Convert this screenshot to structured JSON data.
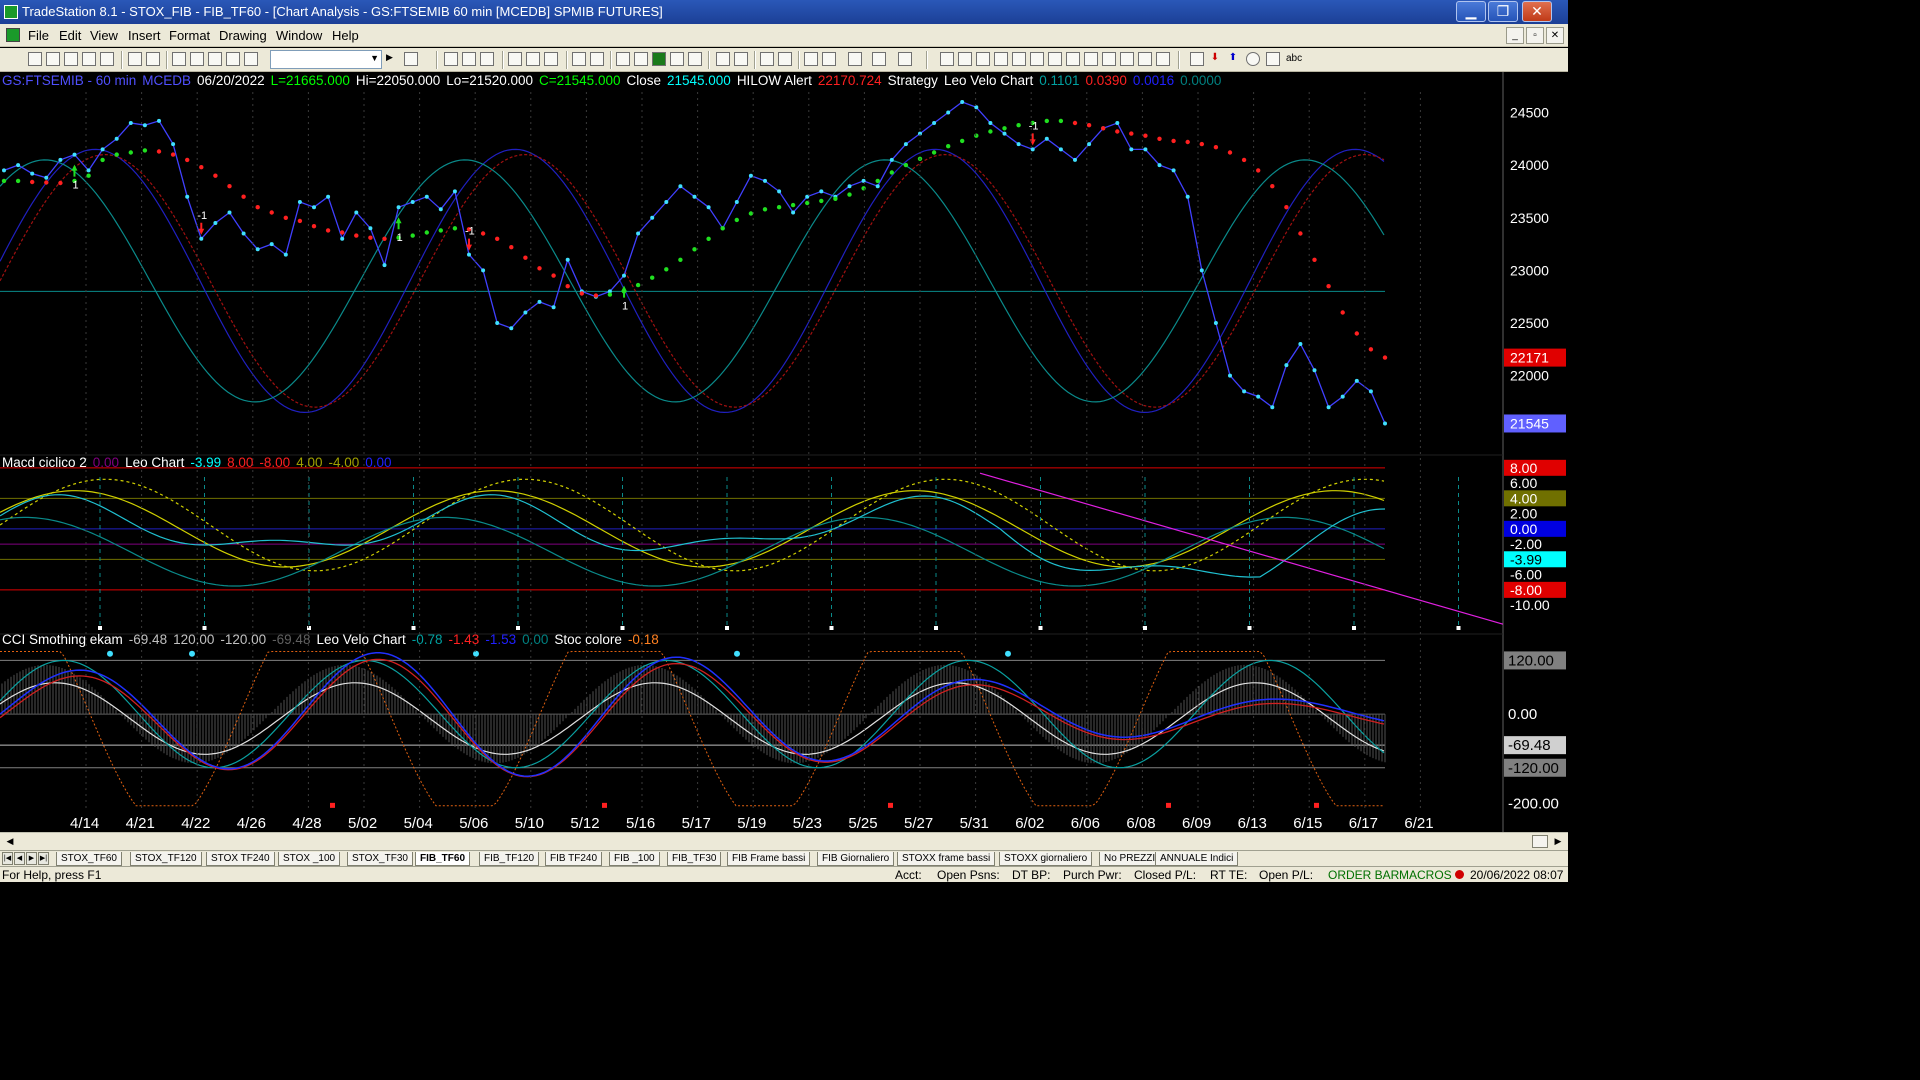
{
  "window": {
    "title": "TradeStation 8.1 - STOX_FIB - FIB_TF60 - [Chart Analysis - GS:FTSEMIB  60 min  [MCEDB] SPMIB FUTURES]",
    "min": "▁",
    "max": "❐",
    "close": "✕"
  },
  "menu": [
    "File",
    "Edit",
    "View",
    "Insert",
    "Format",
    "Drawing",
    "Window",
    "Help"
  ],
  "mdi": [
    "_",
    "▫",
    "✕"
  ],
  "toolbar": {
    "text_tool": "abc"
  },
  "price_header": [
    {
      "t": "GS:FTSEMIB - 60 min",
      "c": "#5050ff"
    },
    {
      "t": "MCEDB",
      "c": "#5050ff"
    },
    {
      "t": "06/20/2022",
      "c": "#ffffff"
    },
    {
      "t": "L=21665.000",
      "c": "#00ff00"
    },
    {
      "t": "Hi=22050.000",
      "c": "#ffffff"
    },
    {
      "t": "Lo=21520.000",
      "c": "#ffffff"
    },
    {
      "t": "C=21545.000",
      "c": "#00ff00"
    },
    {
      "t": "Close",
      "c": "#ffffff"
    },
    {
      "t": "21545.000",
      "c": "#00ffff"
    },
    {
      "t": "HILOW Alert",
      "c": "#ffffff"
    },
    {
      "t": "22170.724",
      "c": "#ff2020"
    },
    {
      "t": "Strategy",
      "c": "#ffffff"
    },
    {
      "t": "Leo Velo Chart",
      "c": "#ffffff"
    },
    {
      "t": "0.1101",
      "c": "#00a0a0"
    },
    {
      "t": "0.0390",
      "c": "#ff2020"
    },
    {
      "t": "0.0016",
      "c": "#2020ff"
    },
    {
      "t": "0.0000",
      "c": "#008080"
    }
  ],
  "macd_header": [
    {
      "t": "Macd ciclico 2",
      "c": "#ffffff"
    },
    {
      "t": "0.00",
      "c": "#800080"
    },
    {
      "t": "Leo Chart",
      "c": "#ffffff"
    },
    {
      "t": "-3.99",
      "c": "#00ffff"
    },
    {
      "t": "8.00",
      "c": "#ff2020"
    },
    {
      "t": "-8.00",
      "c": "#ff2020"
    },
    {
      "t": "4.00",
      "c": "#a0a000"
    },
    {
      "t": "-4.00",
      "c": "#a0a000"
    },
    {
      "t": "0.00",
      "c": "#2020ff"
    }
  ],
  "cci_header": [
    {
      "t": "CCI Smothing ekam",
      "c": "#ffffff"
    },
    {
      "t": "-69.48",
      "c": "#c0c0c0"
    },
    {
      "t": "120.00",
      "c": "#c0c0c0"
    },
    {
      "t": "-120.00",
      "c": "#c0c0c0"
    },
    {
      "t": "-69.48",
      "c": "#606060"
    },
    {
      "t": "Leo Velo Chart",
      "c": "#ffffff"
    },
    {
      "t": "-0.78",
      "c": "#00a0a0"
    },
    {
      "t": "-1.43",
      "c": "#ff2020"
    },
    {
      "t": "-1.53",
      "c": "#2020ff"
    },
    {
      "t": "0.00",
      "c": "#008080"
    },
    {
      "t": "Stoc colore",
      "c": "#ffffff"
    },
    {
      "t": "-0.18",
      "c": "#ff8020"
    }
  ],
  "price_axis": [
    "24500",
    "24000",
    "23500",
    "23000",
    "22500",
    "22000"
  ],
  "price_badges": [
    {
      "t": "22171",
      "bg": "#e00000",
      "fg": "#ffffff",
      "v": 22171
    },
    {
      "t": "21545",
      "bg": "#6060ff",
      "fg": "#ffffff",
      "v": 21545
    }
  ],
  "macd_axis": [
    {
      "t": "8.00",
      "v": 8,
      "bg": "#e00000",
      "fg": "#ffffff"
    },
    {
      "t": "6.00",
      "v": 6,
      "bg": "",
      "fg": "#ffffff"
    },
    {
      "t": "4.00",
      "v": 4,
      "bg": "#707000",
      "fg": "#ffffff"
    },
    {
      "t": "2.00",
      "v": 2,
      "bg": "",
      "fg": "#ffffff"
    },
    {
      "t": "0.00",
      "v": 0,
      "bg": "#0000e0",
      "fg": "#ffffff"
    },
    {
      "t": "-2.00",
      "v": -2,
      "bg": "",
      "fg": "#ffffff"
    },
    {
      "t": "-3.99",
      "v": -3.99,
      "bg": "#00ffff",
      "fg": "#000000"
    },
    {
      "t": "-6.00",
      "v": -6,
      "bg": "",
      "fg": "#ffffff"
    },
    {
      "t": "-8.00",
      "v": -8,
      "bg": "#e00000",
      "fg": "#ffffff"
    },
    {
      "t": "-10.00",
      "v": -10,
      "bg": "",
      "fg": "#ffffff"
    }
  ],
  "cci_axis": [
    {
      "t": "120.00",
      "v": 120,
      "bg": "#808080",
      "fg": "#000000"
    },
    {
      "t": "0.00",
      "v": 0,
      "bg": "",
      "fg": "#ffffff"
    },
    {
      "t": "-69.48",
      "v": -69.48,
      "bg": "#d0d0d0",
      "fg": "#000000"
    },
    {
      "t": "-120.00",
      "v": -120,
      "bg": "#808080",
      "fg": "#000000"
    },
    {
      "t": "-200.00",
      "v": -200,
      "bg": "",
      "fg": "#ffffff"
    }
  ],
  "date_axis": [
    "4/14",
    "4/21",
    "4/22",
    "4/26",
    "4/28",
    "5/02",
    "5/04",
    "5/06",
    "5/10",
    "5/12",
    "5/16",
    "5/17",
    "5/19",
    "5/23",
    "5/25",
    "5/27",
    "5/31",
    "6/02",
    "6/06",
    "6/08",
    "6/09",
    "6/13",
    "6/15",
    "6/17",
    "6/21"
  ],
  "signals": [
    {
      "label": "1",
      "dir": "buy",
      "i": 5
    },
    {
      "label": "-1",
      "dir": "sell",
      "i": 14
    },
    {
      "label": "1",
      "dir": "buy",
      "i": 28
    },
    {
      "label": "-1",
      "dir": "sell",
      "i": 33
    },
    {
      "label": "1",
      "dir": "buy",
      "i": 44
    },
    {
      "label": "-1",
      "dir": "sell",
      "i": 73
    }
  ],
  "chart_data": {
    "type": "line",
    "symbol": "GS:FTSEMIB - 60 min",
    "price_ylim": [
      21350,
      24600
    ],
    "close": [
      23950,
      24000,
      23920,
      23880,
      24050,
      24100,
      23950,
      24150,
      24250,
      24400,
      24380,
      24420,
      24200,
      23700,
      23300,
      23450,
      23550,
      23350,
      23200,
      23250,
      23150,
      23650,
      23600,
      23700,
      23300,
      23550,
      23400,
      23050,
      23600,
      23650,
      23700,
      23580,
      23750,
      23150,
      23000,
      22500,
      22450,
      22600,
      22700,
      22650,
      23100,
      22800,
      22750,
      22800,
      22950,
      23350,
      23500,
      23650,
      23800,
      23700,
      23600,
      23400,
      23650,
      23900,
      23850,
      23750,
      23550,
      23700,
      23750,
      23700,
      23800,
      23850,
      23800,
      24050,
      24200,
      24300,
      24400,
      24500,
      24600,
      24550,
      24400,
      24300,
      24200,
      24150,
      24250,
      24150,
      24050,
      24200,
      24350,
      24400,
      24150,
      24150,
      24000,
      23950,
      23700,
      23000,
      22500,
      22000,
      21850,
      21800,
      21700,
      22100,
      22300,
      22050,
      21700,
      21800,
      21950,
      21850,
      21545
    ],
    "hilow_alert": [
      23850,
      23850,
      23840,
      23835,
      23830,
      23850,
      23900,
      24050,
      24100,
      24120,
      24140,
      24130,
      24100,
      24050,
      23980,
      23900,
      23800,
      23700,
      23600,
      23550,
      23500,
      23470,
      23420,
      23380,
      23360,
      23330,
      23310,
      23300,
      23310,
      23330,
      23360,
      23380,
      23400,
      23390,
      23350,
      23300,
      23220,
      23120,
      23020,
      22950,
      22850,
      22780,
      22760,
      22770,
      22800,
      22860,
      22930,
      23010,
      23100,
      23200,
      23300,
      23400,
      23480,
      23540,
      23580,
      23600,
      23620,
      23640,
      23660,
      23680,
      23720,
      23780,
      23850,
      23930,
      24000,
      24060,
      24120,
      24180,
      24230,
      24280,
      24320,
      24350,
      24380,
      24400,
      24420,
      24420,
      24400,
      24380,
      24350,
      24320,
      24300,
      24280,
      24250,
      24230,
      24220,
      24200,
      24170,
      24120,
      24050,
      23950,
      23800,
      23600,
      23350,
      23100,
      22850,
      22600,
      22400,
      22250,
      22171
    ],
    "macd_ylim": [
      -13,
      8.5
    ],
    "cci_ylim": [
      -210,
      150
    ]
  },
  "tabs": [
    "STOX_TF60",
    "STOX_TF120",
    "STOX TF240",
    "STOX _100",
    "STOX_TF30",
    "FIB_TF60",
    "FIB_TF120",
    "FIB TF240",
    "FIB _100",
    "FIB_TF30",
    "FIB Frame bassi",
    "FIB Giornaliero",
    "STOXX frame bassi",
    "STOXX giornaliero",
    "No PREZZI",
    "ANNUALE Indici"
  ],
  "active_tab": "FIB_TF60",
  "tab_nav": [
    "|◀",
    "◀",
    "▶",
    "▶|"
  ],
  "scroll": {
    "left": "◀",
    "right": "▶"
  },
  "status": {
    "help": "For Help, press F1",
    "acct": "Acct:",
    "open_psns": "Open Psns:",
    "dt_bp": "DT BP:",
    "purch_pwr": "Purch Pwr:",
    "closed_pl": "Closed P/L:",
    "rt_te": "RT TE:",
    "open_pl": "Open P/L:",
    "order_bar": "ORDER BAR",
    "macros": "MACROS",
    "datetime": "20/06/2022 08:07"
  }
}
